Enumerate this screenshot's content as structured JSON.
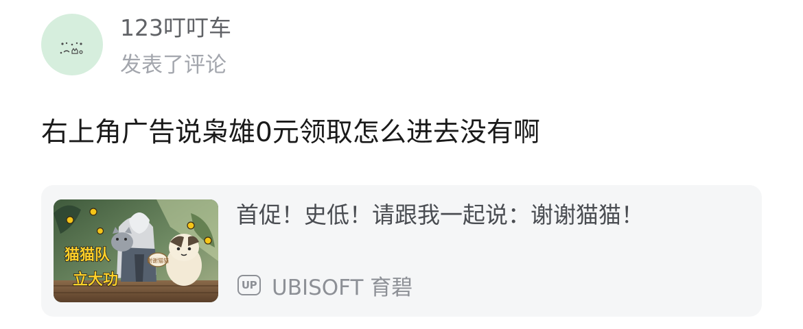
{
  "author": {
    "name": "123叮叮车",
    "action": "发表了评论",
    "avatar_icon": "cat-doodle-avatar-icon"
  },
  "comment": {
    "text": "右上角广告说枭雄0元领取怎么进去没有啊"
  },
  "linked_card": {
    "title": "首促！史低！请跟我一起说：谢谢猫猫！",
    "thumbnail": {
      "line1": "猫猫队",
      "line2": "立大功",
      "sticker": "谢谢猫猫"
    },
    "source": {
      "badge": "UP",
      "name": "UBISOFT 育碧"
    }
  },
  "colors": {
    "avatar_bg": "#d6eedd",
    "card_bg": "#f5f6f7",
    "secondary_text": "#a3a6ad",
    "username_text": "#606266"
  }
}
